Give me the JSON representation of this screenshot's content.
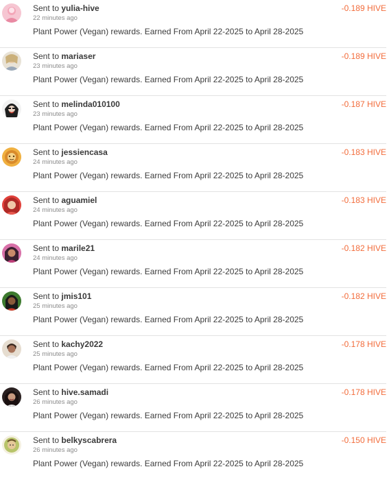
{
  "transfers": [
    {
      "prefix": "Sent to",
      "user": "yulia-hive",
      "time": "22 minutes ago",
      "memo": "Plant Power (Vegan) rewards. Earned From April 22-2025 to April 28-2025",
      "amount": "-0.189 HIVE",
      "avatar_color": "#f3a6b8"
    },
    {
      "prefix": "Sent to",
      "user": "mariaser",
      "time": "23 minutes ago",
      "memo": "Plant Power (Vegan) rewards. Earned From April 22-2025 to April 28-2025",
      "amount": "-0.189 HIVE",
      "avatar_color": "#d9c7a3"
    },
    {
      "prefix": "Sent to",
      "user": "melinda010100",
      "time": "23 minutes ago",
      "memo": "Plant Power (Vegan) rewards. Earned From April 22-2025 to April 28-2025",
      "amount": "-0.187 HIVE",
      "avatar_color": "#2b2b2b"
    },
    {
      "prefix": "Sent to",
      "user": "jessiencasa",
      "time": "24 minutes ago",
      "memo": "Plant Power (Vegan) rewards. Earned From April 22-2025 to April 28-2025",
      "amount": "-0.183 HIVE",
      "avatar_color": "#d98a2b"
    },
    {
      "prefix": "Sent to",
      "user": "aguamiel",
      "time": "24 minutes ago",
      "memo": "Plant Power (Vegan) rewards. Earned From April 22-2025 to April 28-2025",
      "amount": "-0.183 HIVE",
      "avatar_color": "#e0403a"
    },
    {
      "prefix": "Sent to",
      "user": "marile21",
      "time": "24 minutes ago",
      "memo": "Plant Power (Vegan) rewards. Earned From April 22-2025 to April 28-2025",
      "amount": "-0.182 HIVE",
      "avatar_color": "#c0407a"
    },
    {
      "prefix": "Sent to",
      "user": "jmis101",
      "time": "25 minutes ago",
      "memo": "Plant Power (Vegan) rewards. Earned From April 22-2025 to April 28-2025",
      "amount": "-0.182 HIVE",
      "avatar_color": "#3d7a2e"
    },
    {
      "prefix": "Sent to",
      "user": "kachy2022",
      "time": "25 minutes ago",
      "memo": "Plant Power (Vegan) rewards. Earned From April 22-2025 to April 28-2025",
      "amount": "-0.178 HIVE",
      "avatar_color": "#c9a58a"
    },
    {
      "prefix": "Sent to",
      "user": "hive.samadi",
      "time": "26 minutes ago",
      "memo": "Plant Power (Vegan) rewards. Earned From April 22-2025 to April 28-2025",
      "amount": "-0.178 HIVE",
      "avatar_color": "#3a2a2a"
    },
    {
      "prefix": "Sent to",
      "user": "belkyscabrera",
      "time": "26 minutes ago",
      "memo": "Plant Power (Vegan) rewards. Earned From April 22-2025 to April 28-2025",
      "amount": "-0.150 HIVE",
      "avatar_color": "#b8c46a"
    }
  ],
  "colors": {
    "amount_negative": "#f26b3a",
    "divider": "#e2e2e2"
  }
}
